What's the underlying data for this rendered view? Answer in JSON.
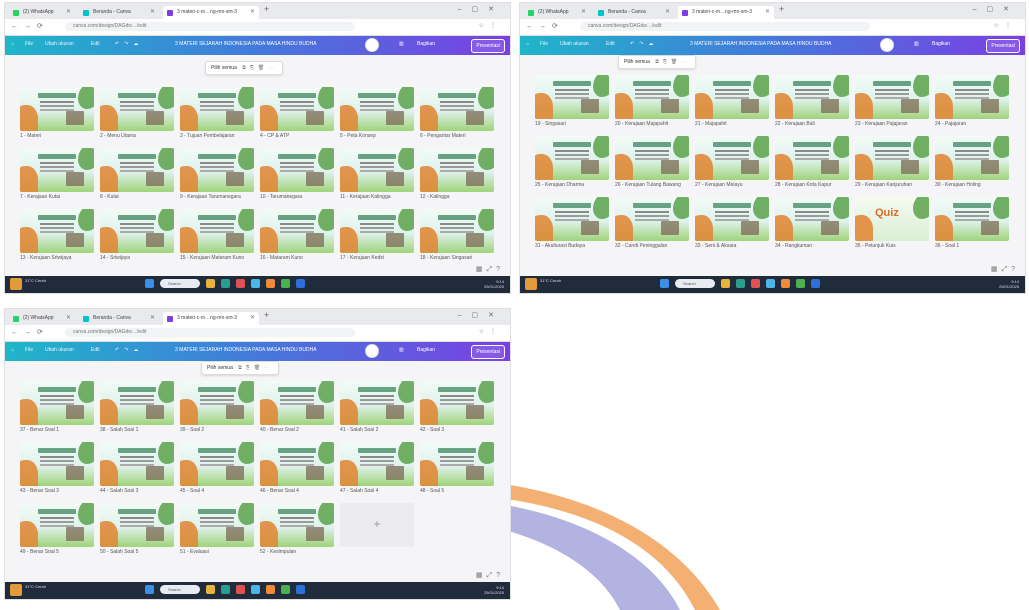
{
  "colors": {
    "toolbar_start": "#1fb6c9",
    "toolbar_end": "#7b3fe4",
    "taskbar": "#202b3c",
    "accent_orange": "#e08a3a",
    "accent_green": "#5aa24a"
  },
  "screenshots": [
    {
      "browser": {
        "tabs": [
          "(2) WhatsApp",
          "Beranda - Canva",
          "3 materi-c-m…ng-mn-sm-3"
        ],
        "url": "canva.com/design/DAGdw…/edit"
      },
      "canva": {
        "menu": [
          "File",
          "Ubah ukuran",
          "Edit"
        ],
        "title": "3 MATERI SEJARAH INDONESIA PADA MASA HINDU BUDHA",
        "share": "Bagikan",
        "present": "Presentasi"
      },
      "floating_toolbar": {
        "label": "Pilih semua"
      },
      "slides": [
        {
          "num": "1",
          "label": "Materi",
          "kind": "slide"
        },
        {
          "num": "2",
          "label": "Menu Utama",
          "kind": "slide"
        },
        {
          "num": "3",
          "label": "Tujuan Pembelajaran",
          "kind": "slide"
        },
        {
          "num": "4",
          "label": "CP & ATP",
          "kind": "slide"
        },
        {
          "num": "5",
          "label": "Peta Konsep",
          "kind": "slide"
        },
        {
          "num": "6",
          "label": "Pengantar Materi",
          "kind": "slide"
        },
        {
          "num": "7",
          "label": "Kerajaan Kutai",
          "kind": "slide"
        },
        {
          "num": "8",
          "label": "Kutai",
          "kind": "slide"
        },
        {
          "num": "9",
          "label": "Kerajaan Tarumanegara",
          "kind": "slide"
        },
        {
          "num": "10",
          "label": "Tarumanegara",
          "kind": "slide"
        },
        {
          "num": "11",
          "label": "Kerajaan Kalingga",
          "kind": "slide"
        },
        {
          "num": "12",
          "label": "Kalingga",
          "kind": "slide"
        },
        {
          "num": "13",
          "label": "Kerajaan Sriwijaya",
          "kind": "slide"
        },
        {
          "num": "14",
          "label": "Sriwijaya",
          "kind": "slide"
        },
        {
          "num": "15",
          "label": "Kerajaan Mataram Kuno",
          "kind": "slide"
        },
        {
          "num": "16",
          "label": "Mataram Kuno",
          "kind": "slide"
        },
        {
          "num": "17",
          "label": "Kerajaan Kediri",
          "kind": "slide"
        },
        {
          "num": "18",
          "label": "Kerajaan Singasari",
          "kind": "slide"
        }
      ]
    },
    {
      "browser": {
        "tabs": [
          "(2) WhatsApp",
          "Beranda - Canva",
          "3 materi-c-m…ng-mn-sm-3"
        ],
        "url": "canva.com/design/DAGdw…/edit"
      },
      "canva": {
        "menu": [
          "File",
          "Ubah ukuran",
          "Edit"
        ],
        "title": "3 MATERI SEJARAH INDONESIA PADA MASA HINDU BUDHA",
        "share": "Bagikan",
        "present": "Presentasi"
      },
      "floating_toolbar": {
        "label": "Pilih semua"
      },
      "slides": [
        {
          "num": "19",
          "label": "Singasari",
          "kind": "slide"
        },
        {
          "num": "20",
          "label": "Kerajaan Majapahit",
          "kind": "slide"
        },
        {
          "num": "21",
          "label": "Majapahit",
          "kind": "slide"
        },
        {
          "num": "22",
          "label": "Kerajaan Bali",
          "kind": "slide"
        },
        {
          "num": "23",
          "label": "Kerajaan Pajajaran",
          "kind": "slide"
        },
        {
          "num": "24",
          "label": "Pajajaran",
          "kind": "slide"
        },
        {
          "num": "25",
          "label": "Kerajaan Dharma",
          "kind": "slide"
        },
        {
          "num": "26",
          "label": "Kerajaan Tulang Bawang",
          "kind": "slide"
        },
        {
          "num": "27",
          "label": "Kerajaan Melayu",
          "kind": "slide"
        },
        {
          "num": "28",
          "label": "Kerajaan Kota Kapur",
          "kind": "slide"
        },
        {
          "num": "29",
          "label": "Kerajaan Kanjuruhan",
          "kind": "slide"
        },
        {
          "num": "30",
          "label": "Kerajaan Holing",
          "kind": "slide"
        },
        {
          "num": "31",
          "label": "Akulturasi Budaya",
          "kind": "slide"
        },
        {
          "num": "32",
          "label": "Candi Peninggalan",
          "kind": "slide"
        },
        {
          "num": "33",
          "label": "Seni & Aksara",
          "kind": "slide"
        },
        {
          "num": "34",
          "label": "Rangkuman",
          "kind": "slide"
        },
        {
          "num": "35",
          "label": "Petunjuk Kuis",
          "kind": "quiz",
          "quiz_word": "Quiz"
        },
        {
          "num": "36",
          "label": "Soal 1",
          "kind": "slide"
        }
      ]
    },
    {
      "browser": {
        "tabs": [
          "(2) WhatsApp",
          "Beranda - Canva",
          "3 materi-c-m…ng-mn-sm-3"
        ],
        "url": "canva.com/design/DAGdw…/edit"
      },
      "canva": {
        "menu": [
          "File",
          "Ubah ukuran",
          "Edit"
        ],
        "title": "3 MATERI SEJARAH INDONESIA PADA MASA HINDU BUDHA",
        "share": "Bagikan",
        "present": "Presentasi"
      },
      "floating_toolbar": {
        "label": "Pilih semua"
      },
      "slides": [
        {
          "num": "37",
          "label": "Benar Soal 1",
          "kind": "slide"
        },
        {
          "num": "38",
          "label": "Salah Soal 1",
          "kind": "slide"
        },
        {
          "num": "39",
          "label": "Soal 2",
          "kind": "slide"
        },
        {
          "num": "40",
          "label": "Benar Soal 2",
          "kind": "slide"
        },
        {
          "num": "41",
          "label": "Salah Soal 2",
          "kind": "slide"
        },
        {
          "num": "42",
          "label": "Soal 3",
          "kind": "slide"
        },
        {
          "num": "43",
          "label": "Benar Soal 3",
          "kind": "slide"
        },
        {
          "num": "44",
          "label": "Salah Soal 3",
          "kind": "slide"
        },
        {
          "num": "45",
          "label": "Soal 4",
          "kind": "slide"
        },
        {
          "num": "46",
          "label": "Benar Soal 4",
          "kind": "slide"
        },
        {
          "num": "47",
          "label": "Salah Soal 4",
          "kind": "slide"
        },
        {
          "num": "48",
          "label": "Soal 5",
          "kind": "slide"
        },
        {
          "num": "49",
          "label": "Benar Soal 5",
          "kind": "slide"
        },
        {
          "num": "50",
          "label": "Salah Soal 5",
          "kind": "slide"
        },
        {
          "num": "51",
          "label": "Evaluasi",
          "kind": "slide"
        },
        {
          "num": "52",
          "label": "Kesimpulan",
          "kind": "slide"
        },
        {
          "num": "",
          "label": "",
          "kind": "add",
          "plus": "+"
        }
      ]
    }
  ],
  "taskbar": {
    "weather": "31°C Cerah",
    "search": "Search",
    "clock_time": "9:14",
    "clock_date": "25/01/2025"
  }
}
